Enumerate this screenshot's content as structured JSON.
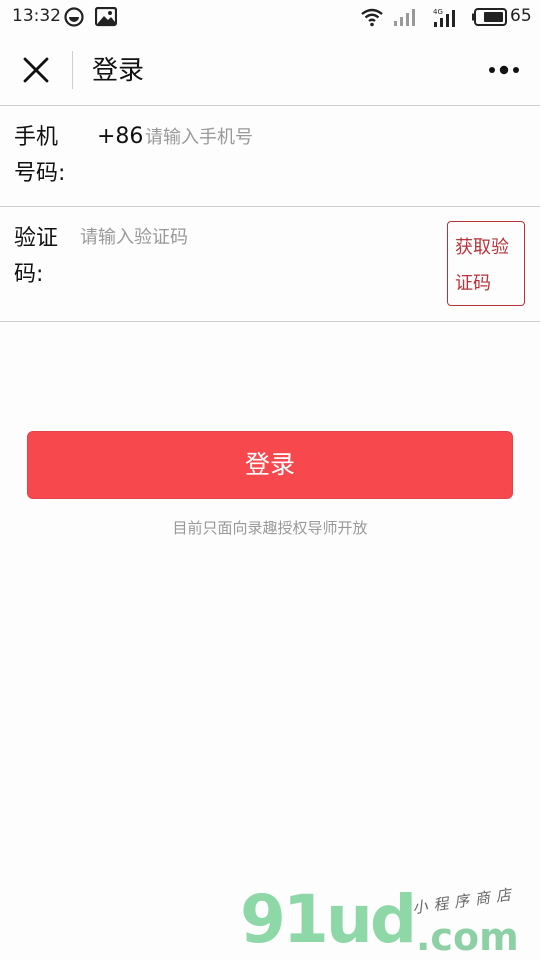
{
  "status_bar": {
    "time": "13:32",
    "battery": "65",
    "icons": [
      "browser-notification-icon",
      "image-notification-icon",
      "wifi-icon",
      "signal-icon",
      "4g-signal-icon",
      "battery-icon"
    ]
  },
  "nav": {
    "title": "登录",
    "close_icon": "close-icon",
    "more_icon": "more-icon"
  },
  "form": {
    "phone_label": "手机号码:",
    "phone_prefix": "+86",
    "phone_placeholder": "请输入手机号",
    "phone_value": "",
    "code_label": "验证码:",
    "code_placeholder": "请输入验证码",
    "code_value": "",
    "get_code_button": "获取验证码"
  },
  "login_button": "登录",
  "notice": "目前只面向录趣授权导师开放",
  "watermark": {
    "logo": "91ud",
    "domain": ".com",
    "tagline": "小程序商店"
  },
  "colors": {
    "accent": "#f7484e",
    "code_button": "#b8343a",
    "placeholder": "#999999"
  }
}
